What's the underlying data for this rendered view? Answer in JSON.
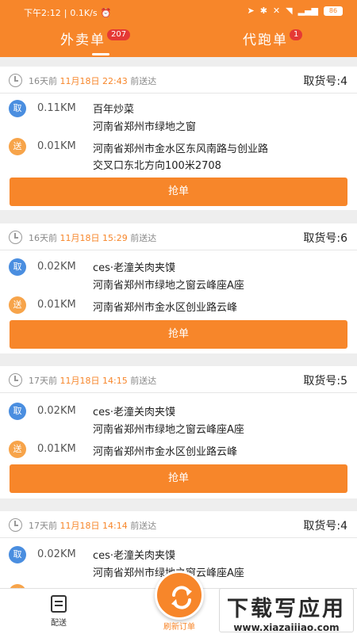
{
  "status_bar": {
    "time": "下午2:12",
    "speed": "0.1K/s",
    "battery": "86"
  },
  "tabs": [
    {
      "label": "外卖单",
      "count": "207"
    },
    {
      "label": "代跑单",
      "count": "1"
    }
  ],
  "orders": [
    {
      "days_ago": "16天前",
      "date": "11月18日",
      "time": "22:43",
      "deliver_suffix": "前送达",
      "pickup_label": "取货号:",
      "pickup_no": "4",
      "pickup_badge": "取",
      "pickup_distance": "0.11KM",
      "pickup_line1": "百年炒菜",
      "pickup_line2": "河南省郑州市绿地之窗",
      "send_badge": "送",
      "send_distance": "0.01KM",
      "send_line1": "河南省郑州市金水区东风南路与创业路",
      "send_line2": "交叉口东北方向100米2708",
      "button": "抢单"
    },
    {
      "days_ago": "16天前",
      "date": "11月18日",
      "time": "15:29",
      "deliver_suffix": "前送达",
      "pickup_label": "取货号:",
      "pickup_no": "6",
      "pickup_badge": "取",
      "pickup_distance": "0.02KM",
      "pickup_line1": "ces·老潼关肉夹馍",
      "pickup_line2": "河南省郑州市绿地之窗云峰座A座",
      "send_badge": "送",
      "send_distance": "0.01KM",
      "send_line1": "河南省郑州市金水区创业路云峰",
      "send_line2": "",
      "button": "抢单"
    },
    {
      "days_ago": "17天前",
      "date": "11月18日",
      "time": "14:15",
      "deliver_suffix": "前送达",
      "pickup_label": "取货号:",
      "pickup_no": "5",
      "pickup_badge": "取",
      "pickup_distance": "0.02KM",
      "pickup_line1": "ces·老潼关肉夹馍",
      "pickup_line2": "河南省郑州市绿地之窗云峰座A座",
      "send_badge": "送",
      "send_distance": "0.01KM",
      "send_line1": "河南省郑州市金水区创业路云峰",
      "send_line2": "",
      "button": "抢单"
    },
    {
      "days_ago": "17天前",
      "date": "11月18日",
      "time": "14:14",
      "deliver_suffix": "前送达",
      "pickup_label": "取货号:",
      "pickup_no": "4",
      "pickup_badge": "取",
      "pickup_distance": "0.02KM",
      "pickup_line1": "ces·老潼关肉夹馍",
      "pickup_line2": "河南省郑州市绿地之窗云峰座A座",
      "send_badge": "送",
      "send_distance": "",
      "send_line1": "",
      "send_line2": "",
      "button": ""
    }
  ],
  "bottom_nav": {
    "delivery_label": "配送",
    "refresh_label": "刷新订单"
  },
  "watermark": {
    "title": "下载写应用",
    "url": "www.xiazaiiiao.com"
  },
  "colors": {
    "accent": "#f7862a",
    "pickup_badge": "#4a8ee0",
    "send_badge": "#f7a44a",
    "tab_badge": "#e53935"
  }
}
